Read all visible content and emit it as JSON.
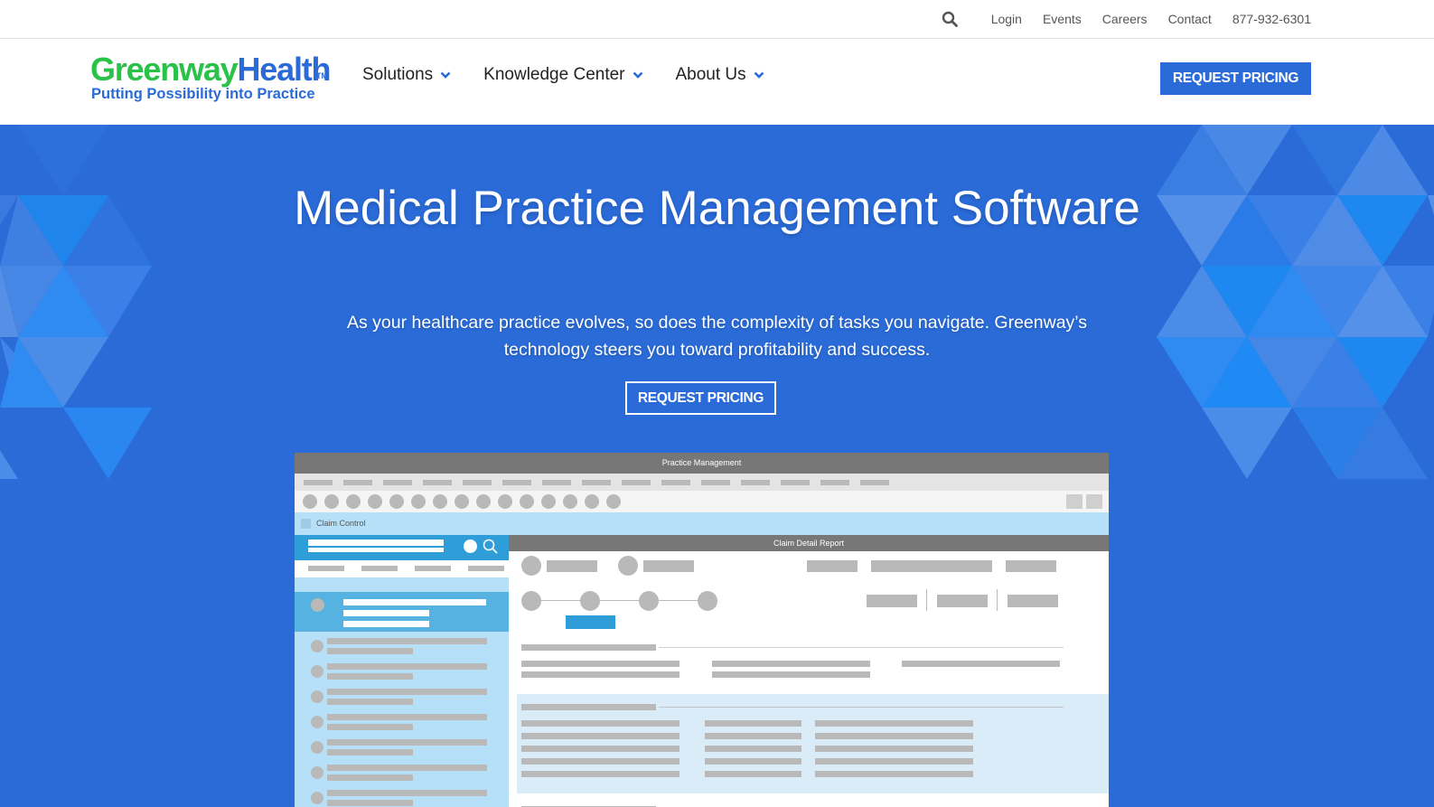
{
  "utility_bar": {
    "links": [
      "Login",
      "Events",
      "Careers",
      "Contact",
      "877-932-6301"
    ]
  },
  "logo": {
    "word_green": "Greenway",
    "word_blue": "Health",
    "trademark": "TM",
    "tagline": "Putting Possibility into Practice"
  },
  "nav": {
    "items": [
      "Solutions",
      "Knowledge Center",
      "About Us"
    ]
  },
  "header_cta": "REQUEST PRICING",
  "hero": {
    "title": "Medical Practice Management Software",
    "subtitle": "As your healthcare practice evolves, so does the complexity of tasks you navigate. Greenway’s technology steers you toward profitability and success.",
    "cta": "REQUEST PRICING"
  },
  "mockup": {
    "window_title": "Practice Management",
    "claim_control_label": "Claim Control",
    "detail_title": "Claim Detail Report"
  },
  "colors": {
    "brand_blue": "#2a6bd8",
    "brand_green": "#2bc24a"
  }
}
